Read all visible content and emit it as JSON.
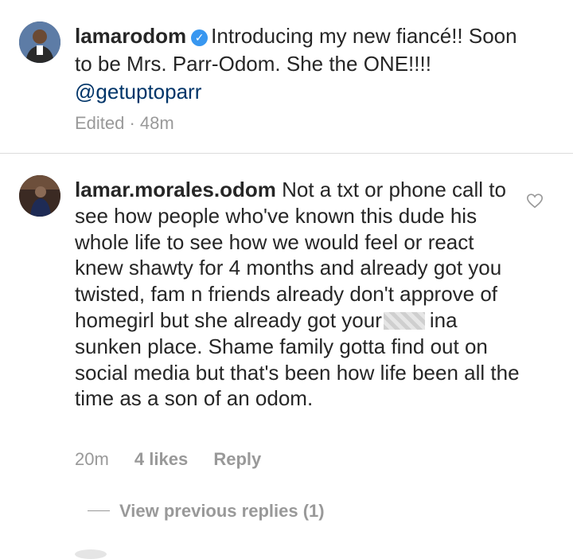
{
  "post": {
    "username": "lamarodom",
    "verified_icon": "verified-badge-icon",
    "caption_line1": "Introducing my new fiancé!! Soon",
    "caption_line2": "to be Mrs. Parr-Odom. She the ONE!!!!",
    "mention": "@getuptoparr",
    "meta": "Edited · 48m"
  },
  "comment": {
    "username": "lamar.morales.odom",
    "text_part1": "Not a txt or phone call to see how people who've known this dude his whole life to see how we would feel or react knew shawty for 4 months and already got you twisted, fam n friends already don't approve of homegirl but she already got your",
    "text_part2": "ina sunken place. Shame family gotta find out on social media but that's been how life been all the time as a son of an odom.",
    "time": "20m",
    "likes": "4 likes",
    "reply": "Reply",
    "view_replies": "View previous replies (1)",
    "like_icon": "heart-outline-icon"
  },
  "colors": {
    "text": "#262626",
    "meta": "#999999",
    "verified": "#3897f0",
    "mention": "#003569",
    "divider": "#dbdbdb"
  }
}
